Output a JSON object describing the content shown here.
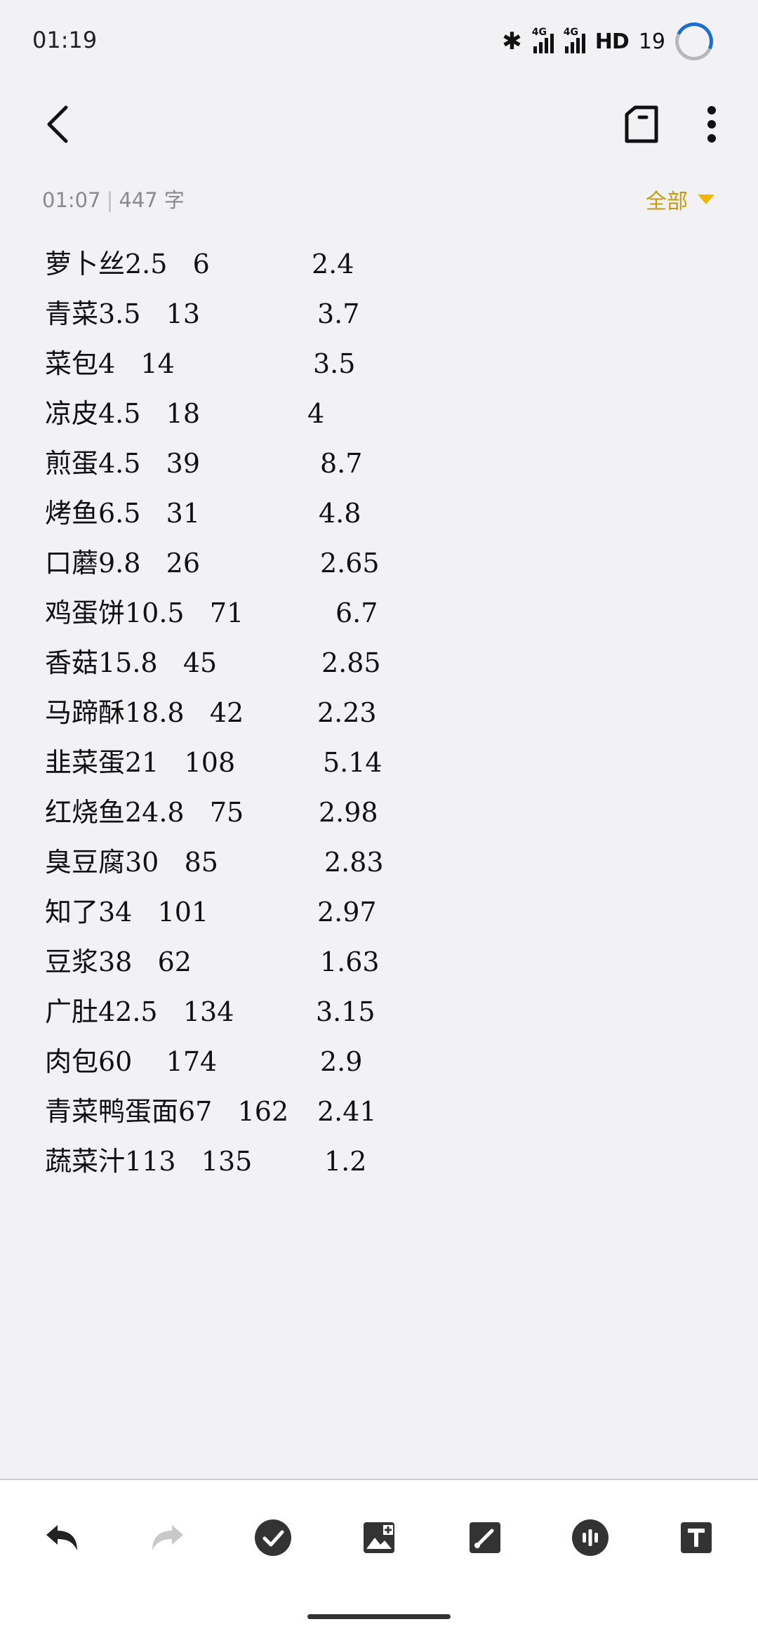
{
  "status": {
    "time": "01:19",
    "network_1": "4G",
    "network_2": "4G",
    "hd_label": "HD",
    "battery": "19"
  },
  "meta": {
    "time": "01:07",
    "separator": "|",
    "word_count": "447 字"
  },
  "filter": {
    "label": "全部"
  },
  "note_lines": [
    {
      "text": "萝卜丝2.5   6",
      "ratio": "2.4"
    },
    {
      "text": "青菜3.5   13",
      "ratio": "3.7"
    },
    {
      "text": "菜包4   14",
      "ratio": "3.5"
    },
    {
      "text": "凉皮4.5   18",
      "ratio": "4"
    },
    {
      "text": "煎蛋4.5   39",
      "ratio": "8.7"
    },
    {
      "text": "烤鱼6.5   31",
      "ratio": "4.8"
    },
    {
      "text": "口蘑9.8   26",
      "ratio": "2.65"
    },
    {
      "text": "鸡蛋饼10.5   71",
      "ratio": "6.7"
    },
    {
      "text": "香菇15.8   45",
      "ratio": "2.85"
    },
    {
      "text": "马蹄酥18.8   42",
      "ratio": "2.23"
    },
    {
      "text": "韭菜蛋21   108",
      "ratio": "5.14"
    },
    {
      "text": "红烧鱼24.8   75",
      "ratio": "2.98"
    },
    {
      "text": "臭豆腐30   85",
      "ratio": "2.83"
    },
    {
      "text": "知了34   101",
      "ratio": "2.97"
    },
    {
      "text": "豆浆38   62",
      "ratio": "1.63"
    },
    {
      "text": "广肚42.5   134",
      "ratio": "3.15"
    },
    {
      "text": "肉包60    174",
      "ratio": "2.9"
    },
    {
      "text": "青菜鸭蛋面67   162",
      "ratio": "2.41"
    },
    {
      "text": "蔬菜汁113   135",
      "ratio": "1.2"
    }
  ],
  "icons": {
    "back": "back-arrow-icon",
    "tag": "tag-icon",
    "more": "more-vertical-icon",
    "undo": "undo-icon",
    "redo": "redo-icon",
    "checklist": "check-circle-icon",
    "image": "image-icon",
    "brush": "brush-icon",
    "voice": "voice-icon",
    "text_format": "text-format-icon"
  },
  "colors": {
    "accent": "#c79a12",
    "background": "#f2f2f4"
  }
}
